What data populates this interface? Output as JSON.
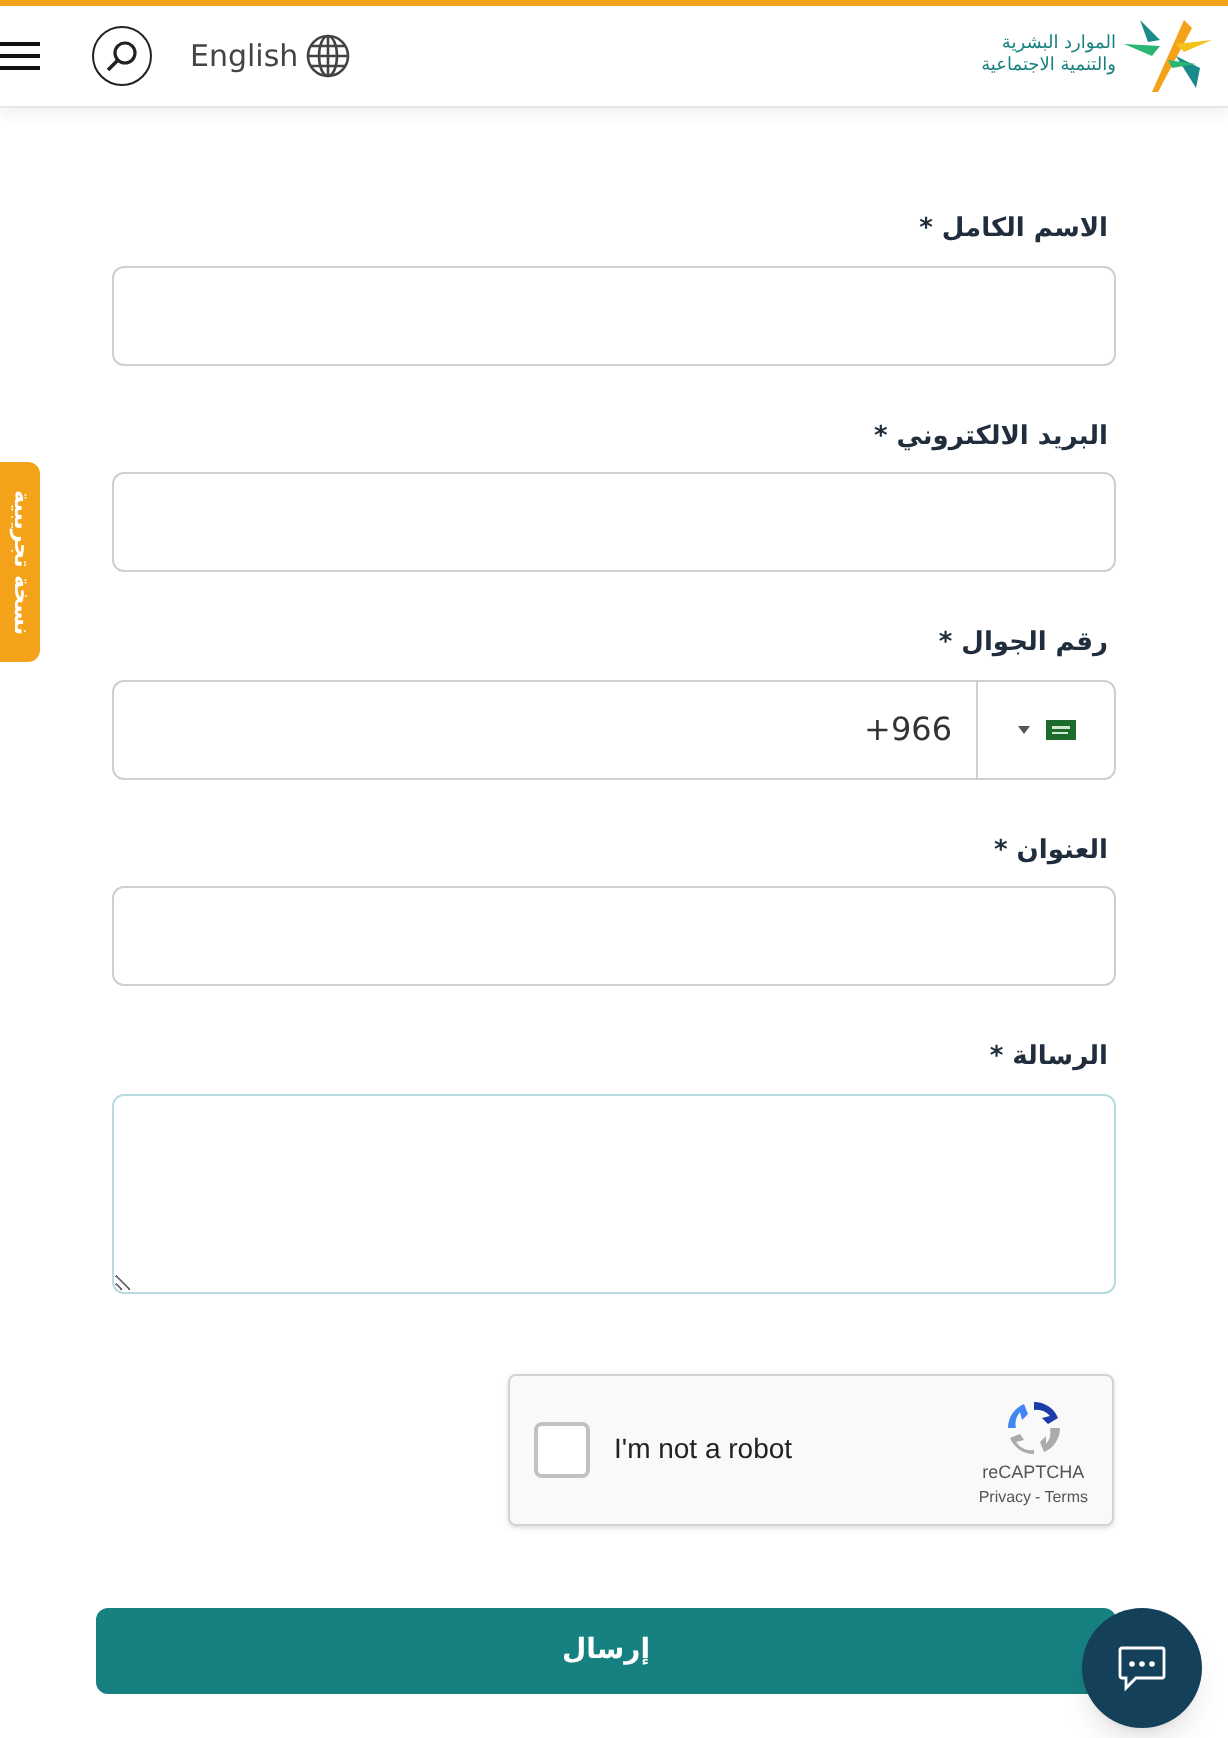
{
  "header": {
    "language": "English",
    "logo_text": [
      "الموارد البشرية",
      "والتنمية الاجتماعية"
    ]
  },
  "side_tab": {
    "label": "نسخة تجريبية"
  },
  "fields": [
    {
      "kind": "text",
      "label": "الاسم الكامل *"
    },
    {
      "kind": "text",
      "label": "البريد الالكتروني *"
    },
    {
      "kind": "phone",
      "label": "رقم الجوال *",
      "value": "+966"
    },
    {
      "kind": "text",
      "label": "العنوان *"
    },
    {
      "kind": "textarea",
      "label": "الرسالة *"
    }
  ],
  "captcha": {
    "label": "I'm not a robot",
    "checked": false,
    "brand": "reCAPTCHA",
    "privacy": "Privacy",
    "separator": "-",
    "terms": "Terms"
  },
  "submit": {
    "label": "إرسال"
  }
}
